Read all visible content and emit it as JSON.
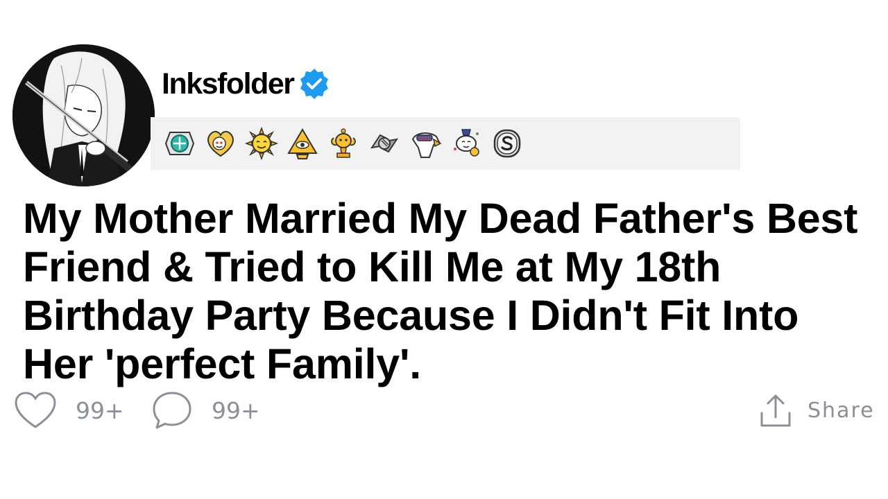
{
  "post": {
    "username": "Inksfolder",
    "verified": true,
    "title": "My Mother Married My Dead Father's Best Friend & Tried to Kill Me at My 18th Birthday Party Because I Didn't Fit Into Her 'perfect Family'."
  },
  "awards": [
    {
      "icon": "silver-medal-award-icon"
    },
    {
      "icon": "wholesome-heart-award-icon"
    },
    {
      "icon": "sun-face-award-icon"
    },
    {
      "icon": "eye-pyramid-award-icon"
    },
    {
      "icon": "gold-trophy-award-icon"
    },
    {
      "icon": "handshake-award-icon"
    },
    {
      "icon": "eagle-award-icon"
    },
    {
      "icon": "snoo-party-award-icon"
    },
    {
      "icon": "silver-coin-award-icon"
    }
  ],
  "actions": {
    "likes": "99+",
    "comments": "99+",
    "share_label": "Share"
  },
  "colors": {
    "verified_blue": "#1d9bf0",
    "action_gray": "#8a8f9a",
    "awards_bar_bg": "#f2f2f2"
  }
}
